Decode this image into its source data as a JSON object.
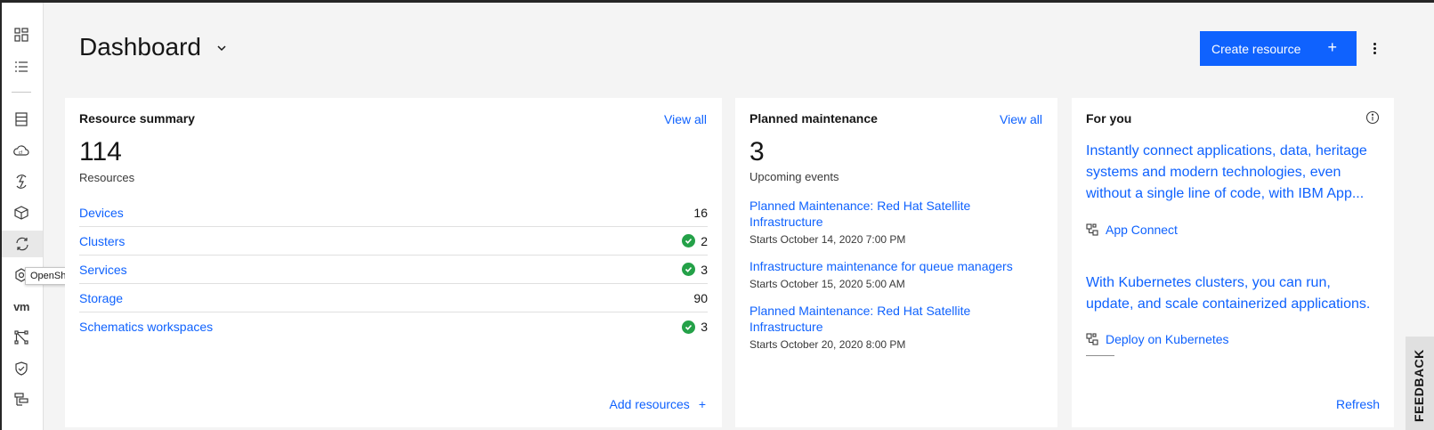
{
  "sidebar": {
    "icons": [
      "dashboard-icon",
      "list-icon",
      "storage-icon",
      "cloud-foundry-icon",
      "functions-icon",
      "cube-icon",
      "kubernetes-icon",
      "openshift-icon",
      "vmware-icon",
      "network-icon",
      "security-icon",
      "toolchain-icon"
    ],
    "vm_text": "vm",
    "tooltip": "OpenShift"
  },
  "header": {
    "title": "Dashboard",
    "create_button": "Create resource",
    "create_plus": "+"
  },
  "resource_summary": {
    "title": "Resource summary",
    "view_all": "View all",
    "count": "114",
    "count_label": "Resources",
    "rows": [
      {
        "label": "Devices",
        "value": "16",
        "ok": false
      },
      {
        "label": "Clusters",
        "value": "2",
        "ok": true
      },
      {
        "label": "Services",
        "value": "3",
        "ok": true
      },
      {
        "label": "Storage",
        "value": "90",
        "ok": false
      },
      {
        "label": "Schematics workspaces",
        "value": "3",
        "ok": true
      }
    ],
    "add_resources": "Add resources",
    "add_plus": "+"
  },
  "planned_maintenance": {
    "title": "Planned maintenance",
    "view_all": "View all",
    "count": "3",
    "count_label": "Upcoming events",
    "events": [
      {
        "title": "Planned Maintenance: Red Hat Satellite Infrastructure",
        "date": "Starts October 14, 2020 7:00 PM"
      },
      {
        "title": "Infrastructure maintenance for queue managers",
        "date": "Starts October 15, 2020 5:00 AM"
      },
      {
        "title": "Planned Maintenance: Red Hat Satellite Infrastructure",
        "date": "Starts October 20, 2020 8:00 PM"
      }
    ]
  },
  "for_you": {
    "title": "For you",
    "promo1_text": "Instantly connect applications, data, heritage systems and modern technologies, even without a single line of code, with IBM App...",
    "promo1_link": "App Connect",
    "promo2_text": "With Kubernetes clusters, you can run, update, and scale containerized applications.",
    "promo2_link": "Deploy on Kubernetes",
    "refresh": "Refresh"
  },
  "feedback": "FEEDBACK"
}
